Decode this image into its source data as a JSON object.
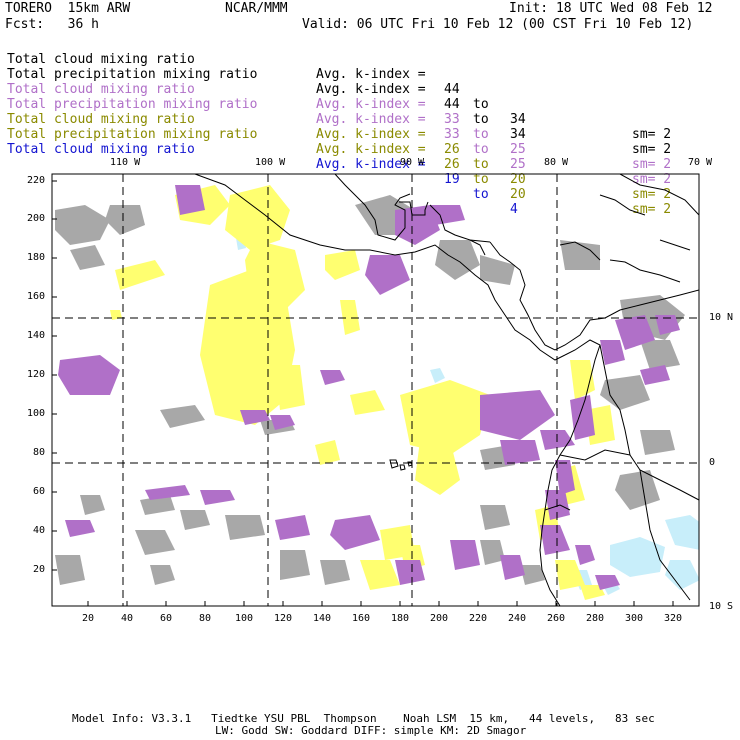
{
  "header": {
    "model": "TORERO  15km ARW",
    "center": "NCAR/MMM",
    "init": "Init: 18 UTC Wed 08 Feb 12",
    "fcst": "Fcst:   36 h",
    "valid": "Valid: 06 UTC Fri 10 Feb 12 (00 CST Fri 10 Feb 12)"
  },
  "legend": [
    {
      "field": "Total cloud mixing ratio",
      "index": "Avg. k-index =",
      "from": "44",
      "to_word": "to",
      "to": "34",
      "sm": "sm= 2",
      "color": "#000000"
    },
    {
      "field": "Total precipitation mixing ratio",
      "index": "Avg. k-index =",
      "from": "44",
      "to_word": "to",
      "to": "34",
      "sm": "sm= 2",
      "color": "#000000"
    },
    {
      "field": "Total cloud mixing ratio",
      "index": "Avg. k-index =",
      "from": "33",
      "to_word": "to",
      "to": "25",
      "sm": "sm= 2",
      "color": "#b070c8"
    },
    {
      "field": "Total precipitation mixing ratio",
      "index": "Avg. k-index =",
      "from": "33",
      "to_word": "to",
      "to": "25",
      "sm": "sm= 2",
      "color": "#b070c8"
    },
    {
      "field": "Total cloud mixing ratio",
      "index": "Avg. k-index =",
      "from": "26",
      "to_word": "to",
      "to": "20",
      "sm": "sm= 2",
      "color": "#8a8a00"
    },
    {
      "field": "Total precipitation mixing ratio",
      "index": "Avg. k-index =",
      "from": "26",
      "to_word": "to",
      "to": "20",
      "sm": "sm= 2",
      "color": "#8a8a00"
    },
    {
      "field": "Total cloud mixing ratio",
      "index": "Avg. k-index =",
      "from": "19",
      "to_word": "to",
      "to": "4",
      "sm": "",
      "color": "#1414d0"
    }
  ],
  "axes": {
    "top_lon": [
      "110 W",
      "100 W",
      "90 W",
      "80 W",
      "70 W"
    ],
    "right_lat": [
      "10 N",
      "0",
      "10 S"
    ],
    "left_ticks": [
      "220",
      "200",
      "180",
      "160",
      "140",
      "120",
      "100",
      "80",
      "60",
      "40",
      "20"
    ],
    "bottom_ticks": [
      "20",
      "40",
      "60",
      "80",
      "100",
      "120",
      "140",
      "160",
      "180",
      "200",
      "220",
      "240",
      "260",
      "280",
      "300",
      "320"
    ]
  },
  "footer": {
    "line1": "Model Info: V3.3.1   Tiedtke YSU PBL  Thompson    Noah LSM  15 km,   44 levels,   83 sec",
    "line2": "LW: Godd SW: Goddard DIFF: simple KM: 2D Smagor"
  },
  "colors": {
    "gray": "#a8a8a8",
    "purple": "#b070c8",
    "yellow": "#ffff70",
    "lightblue": "#c8eefa"
  }
}
